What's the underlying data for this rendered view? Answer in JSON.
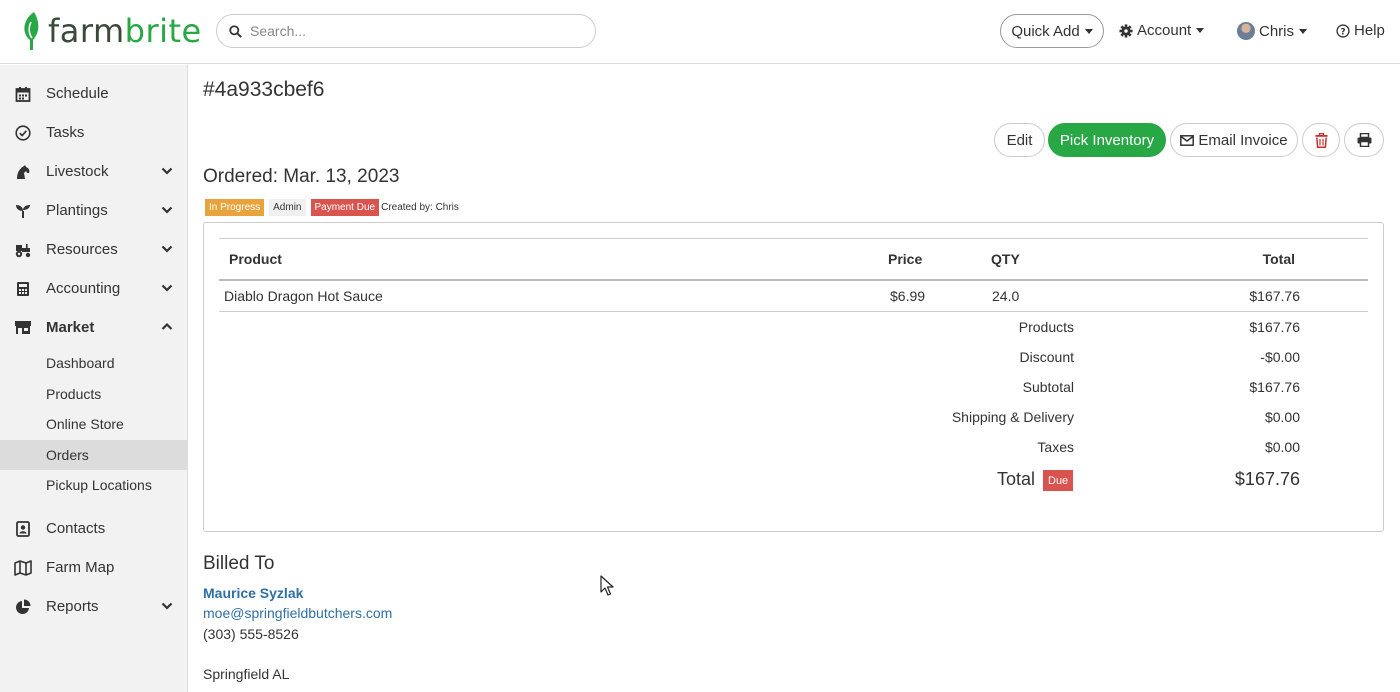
{
  "brand": {
    "logo_text_a": "farm",
    "logo_text_b": "brite",
    "accent": "#28a745"
  },
  "header": {
    "search_placeholder": "Search...",
    "quick_add": "Quick Add",
    "account": "Account",
    "user": "Chris",
    "help": "Help"
  },
  "sidebar": {
    "items": [
      {
        "label": "Schedule",
        "icon": "calendar-icon"
      },
      {
        "label": "Tasks",
        "icon": "check-circle-icon"
      },
      {
        "label": "Livestock",
        "icon": "horse-icon"
      },
      {
        "label": "Plantings",
        "icon": "seedling-icon"
      },
      {
        "label": "Resources",
        "icon": "tractor-icon"
      },
      {
        "label": "Accounting",
        "icon": "calculator-icon"
      },
      {
        "label": "Market",
        "icon": "store-icon"
      },
      {
        "label": "Contacts",
        "icon": "address-book-icon"
      },
      {
        "label": "Farm Map",
        "icon": "map-icon"
      },
      {
        "label": "Reports",
        "icon": "pie-chart-icon"
      }
    ],
    "market_sub": [
      "Dashboard",
      "Products",
      "Online Store",
      "Orders",
      "Pickup Locations"
    ],
    "active_sub": "Orders"
  },
  "order": {
    "id": "#4a933cbef6",
    "ordered": "Ordered: Mar. 13, 2023",
    "badges": {
      "status": "In Progress",
      "source": "Admin",
      "payment": "Payment Due",
      "created_by": "Created by: Chris"
    },
    "actions": {
      "edit": "Edit",
      "pick": "Pick Inventory",
      "email": "Email Invoice"
    }
  },
  "table": {
    "headers": {
      "product": "Product",
      "price": "Price",
      "qty": "QTY",
      "total": "Total"
    },
    "rows": [
      {
        "product": "Diablo Dragon Hot Sauce",
        "price": "$6.99",
        "qty": "24.0",
        "total": "$167.76"
      }
    ]
  },
  "summary": {
    "products_label": "Products",
    "products_value": "$167.76",
    "discount_label": "Discount",
    "discount_value": "-$0.00",
    "subtotal_label": "Subtotal",
    "subtotal_value": "$167.76",
    "shipping_label": "Shipping & Delivery",
    "shipping_value": "$0.00",
    "taxes_label": "Taxes",
    "taxes_value": "$0.00",
    "total_label": "Total",
    "total_badge": "Due",
    "total_value": "$167.76"
  },
  "billed_to": {
    "heading": "Billed To",
    "name": "Maurice Syzlak",
    "email": "moe@springfieldbutchers.com",
    "phone": "(303) 555-8526",
    "city": "Springfield AL"
  }
}
